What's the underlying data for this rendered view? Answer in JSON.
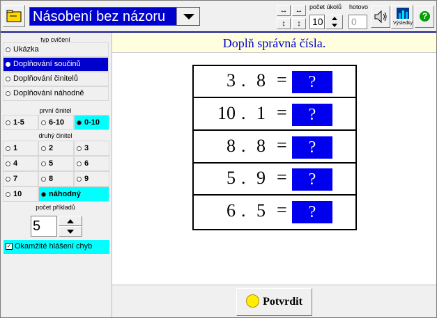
{
  "toolbar": {
    "title": "Násobení bez názoru",
    "pocet_ukolu_label": "počet úkolů",
    "pocet_ukolu_value": "10",
    "hotovo_label": "hotovo",
    "hotovo_value": "0",
    "vysledky_label": "Výsledky",
    "help_glyph": "?",
    "arrows": [
      "↔",
      "↔",
      "↕",
      "↕"
    ]
  },
  "left": {
    "typ_title": "typ cvičení",
    "typ_options": [
      "Ukázka",
      "Doplňování součinů",
      "Doplňování činitelů",
      "Doplňování náhodně"
    ],
    "typ_selected": 1,
    "prvni_title": "první činitel",
    "prvni_options": [
      "1-5",
      "6-10",
      "0-10"
    ],
    "prvni_selected": 2,
    "druhy_title": "druhý činitel",
    "druhy_options": [
      "1",
      "2",
      "3",
      "4",
      "5",
      "6",
      "7",
      "8",
      "9",
      "10",
      "náhodný"
    ],
    "druhy_selected": 10,
    "pocet_title": "počet příkladů",
    "pocet_value": "5",
    "okamzite_label": "Okamžité hlášení chyb",
    "okamzite_checked": "✓"
  },
  "main": {
    "prompt": "Doplň správná čísla.",
    "problems": [
      {
        "a": "3",
        "op": ".",
        "b": "8",
        "eq": "=",
        "answer": "?"
      },
      {
        "a": "10",
        "op": ".",
        "b": "1",
        "eq": "=",
        "answer": "?"
      },
      {
        "a": "8",
        "op": ".",
        "b": "8",
        "eq": "=",
        "answer": "?"
      },
      {
        "a": "5",
        "op": ".",
        "b": "9",
        "eq": "=",
        "answer": "?"
      },
      {
        "a": "6",
        "op": ".",
        "b": "5",
        "eq": "=",
        "answer": "?"
      }
    ],
    "confirm_label": "Potvrdit"
  },
  "colors": {
    "accent_blue": "#0000cc",
    "answer_blue": "#0000ee",
    "selection_cyan": "#00ffff",
    "prompt_bg": "#ffffe0"
  }
}
